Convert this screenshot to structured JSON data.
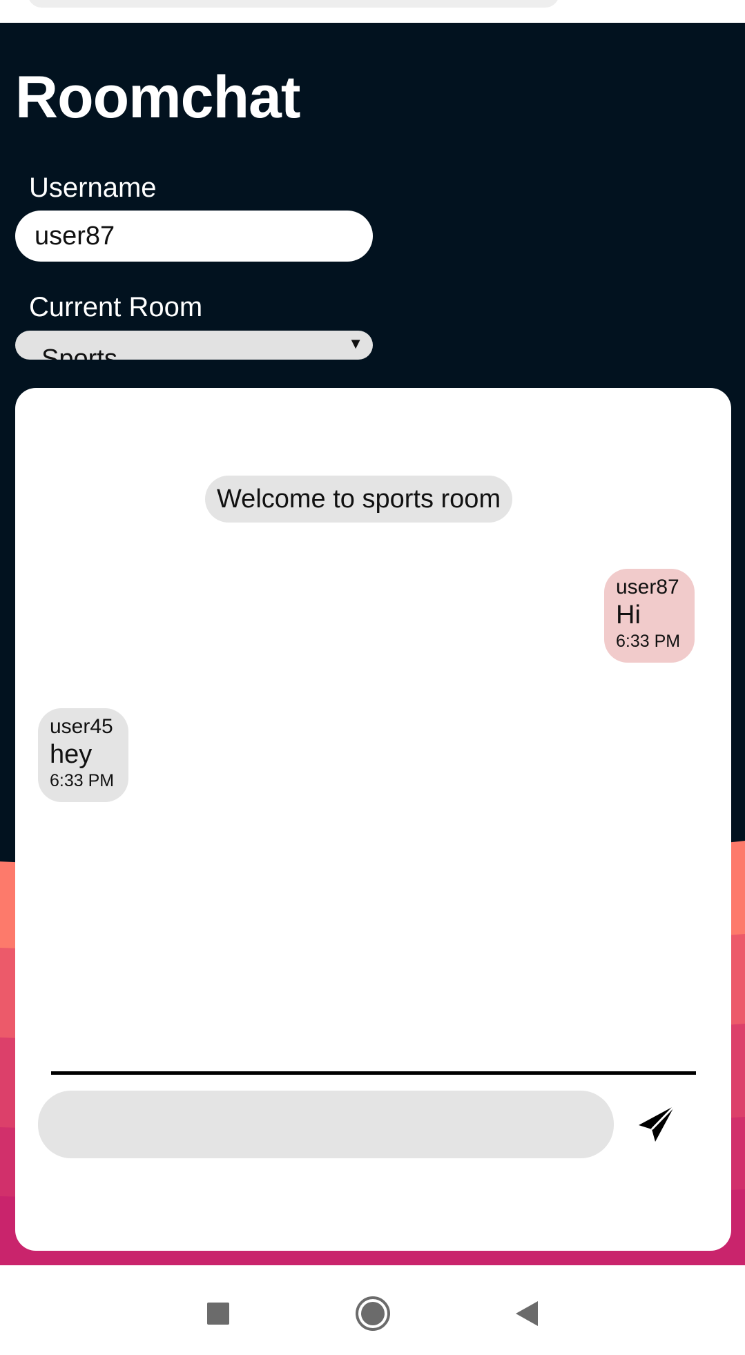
{
  "app": {
    "title": "Roomchat"
  },
  "form": {
    "username_label": "Username",
    "username_value": "user87",
    "room_label": "Current Room",
    "room_value": "Sports"
  },
  "chat": {
    "system_message": "Welcome to sports room",
    "messages": [
      {
        "user": "user87",
        "text": "Hi",
        "time": "6:33 PM",
        "own": true
      },
      {
        "user": "user45",
        "text": "hey",
        "time": "6:33 PM",
        "own": false
      }
    ],
    "input_value": ""
  },
  "icons": {
    "send": "send-icon",
    "nav_recents": "square-icon",
    "nav_home": "circle-icon",
    "nav_back": "triangle-back-icon"
  },
  "colors": {
    "app_background": "#02121f",
    "own_bubble": "#f1cbcb",
    "other_bubble": "#e4e4e4",
    "wave_top": "#fd7a6b",
    "wave_bottom": "#c9246c"
  }
}
